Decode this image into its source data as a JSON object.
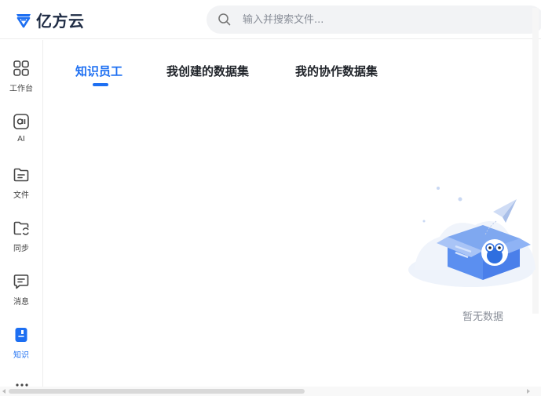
{
  "app": {
    "logo_text": "亿方云"
  },
  "search": {
    "placeholder": "输入并搜索文件..."
  },
  "sidebar": {
    "items": [
      {
        "label": "工作台",
        "icon": "grid-icon"
      },
      {
        "label": "AI",
        "icon": "ai-icon"
      },
      {
        "label": "文件",
        "icon": "folder-icon"
      },
      {
        "label": "同步",
        "icon": "sync-folder-icon"
      },
      {
        "label": "消息",
        "icon": "message-icon"
      },
      {
        "label": "知识",
        "icon": "knowledge-book-icon",
        "active": true
      }
    ],
    "more_icon": "more-icon"
  },
  "tabs": [
    {
      "label": "知识员工",
      "active": true
    },
    {
      "label": "我创建的数据集"
    },
    {
      "label": "我的协作数据集"
    }
  ],
  "empty_state": {
    "text": "暂无数据"
  },
  "colors": {
    "accent": "#1d6ff2",
    "logo_text": "#1f2c45",
    "muted_text": "#8a8f99"
  }
}
